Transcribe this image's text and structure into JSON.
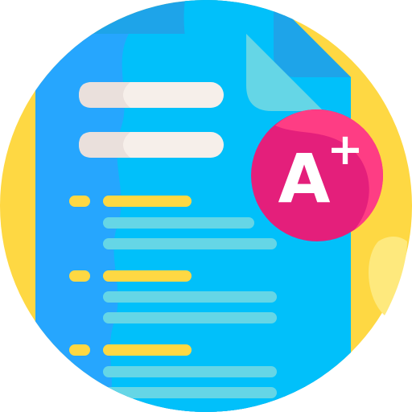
{
  "icon": {
    "name": "graded-documents-icon",
    "grade_letter": "A",
    "grade_modifier": "+"
  },
  "colors": {
    "background_circle": "#FED843",
    "background_circle_light": "#FEE97D",
    "back_page": "#1EA4E9",
    "back_page_light": "#01C0FA",
    "front_page": "#26A6FE",
    "front_page_light": "#01C0FA",
    "page_fold": "#65D6E6",
    "header_bar": "#F6EFEA",
    "header_bar_shade": "#EAE0DC",
    "bullet": "#FED843",
    "line_text": "#65D6E6",
    "badge": "#E41F7B",
    "badge_light": "#FE3D84",
    "badge_text": "#FFFFFF"
  }
}
